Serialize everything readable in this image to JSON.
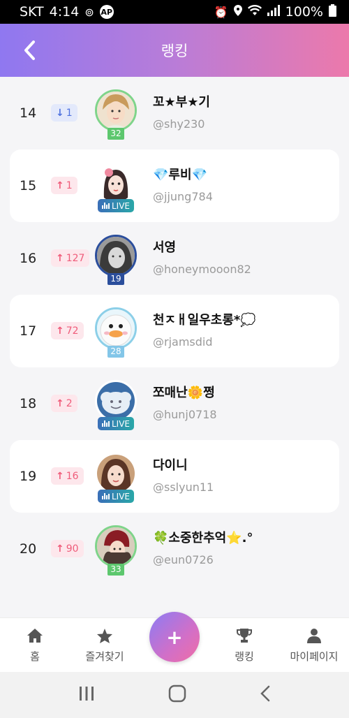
{
  "status_bar": {
    "carrier": "SKT",
    "time": "4:14",
    "ap_badge": "AP",
    "battery": "100%"
  },
  "header": {
    "title": "랭킹"
  },
  "rankings": [
    {
      "rank": "14",
      "direction": "down",
      "change": "1",
      "name": "꼬★부★기",
      "handle": "@shy230",
      "badge": "level",
      "level": "32",
      "ring": "green",
      "card": false
    },
    {
      "rank": "15",
      "direction": "up",
      "change": "1",
      "name": "💎루비💎",
      "handle": "@jjung784",
      "badge": "live",
      "live_label": "LIVE",
      "ring": "live",
      "card": true
    },
    {
      "rank": "16",
      "direction": "up",
      "change": "127",
      "name": "서영",
      "handle": "@honeymooon82",
      "badge": "level",
      "level": "19",
      "ring": "blue",
      "card": false
    },
    {
      "rank": "17",
      "direction": "up",
      "change": "72",
      "name": "천ㅈㅐ일우초롱*💭",
      "handle": "@rjamsdid",
      "badge": "level",
      "level": "28",
      "ring": "sky",
      "card": true
    },
    {
      "rank": "18",
      "direction": "up",
      "change": "2",
      "name": "쪼매난🌼쩡",
      "handle": "@hunj0718",
      "badge": "live",
      "live_label": "LIVE",
      "ring": "live",
      "card": false
    },
    {
      "rank": "19",
      "direction": "up",
      "change": "16",
      "name": "다이니",
      "handle": "@sslyun11",
      "badge": "live",
      "live_label": "LIVE",
      "ring": "live",
      "card": true
    },
    {
      "rank": "20",
      "direction": "up",
      "change": "90",
      "name": "🍀소중한추억⭐.°",
      "handle": "@eun0726",
      "badge": "level",
      "level": "33",
      "ring": "green",
      "card": false
    }
  ],
  "bottom_nav": {
    "home": "홈",
    "favorites": "즐겨찾기",
    "fab": "+",
    "ranking": "랭킹",
    "mypage": "마이페이지"
  },
  "colors": {
    "header_gradient_start": "#8f78f0",
    "header_gradient_end": "#ec79ab",
    "up": "#ef5c7a",
    "down": "#4f72de"
  }
}
